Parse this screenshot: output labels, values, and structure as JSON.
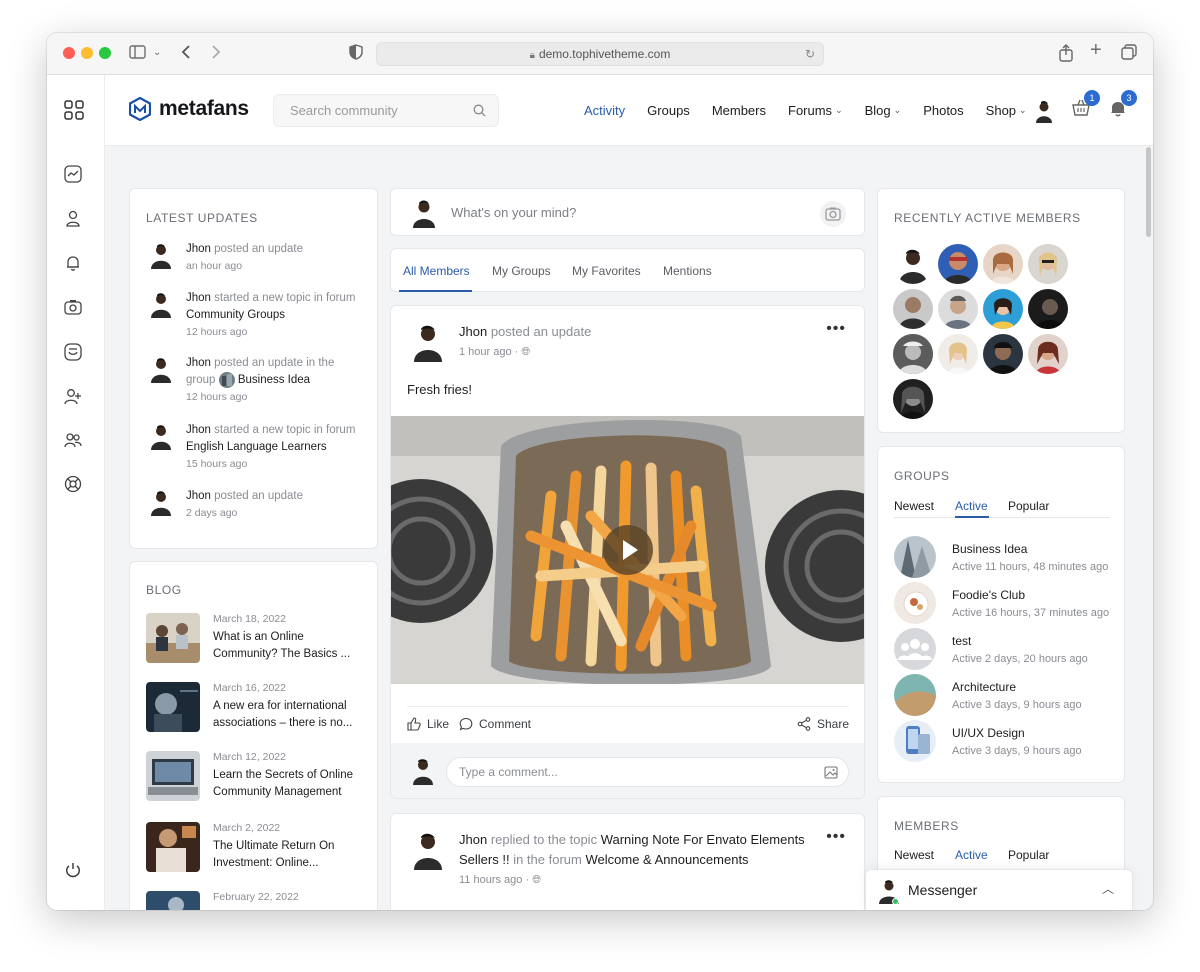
{
  "browser": {
    "url": "demo.tophivetheme.com"
  },
  "header": {
    "logo_text": "metafans",
    "search_placeholder": "Search community",
    "nav": [
      {
        "label": "Activity",
        "active": true,
        "dropdown": false
      },
      {
        "label": "Groups",
        "active": false,
        "dropdown": false
      },
      {
        "label": "Members",
        "active": false,
        "dropdown": false
      },
      {
        "label": "Forums",
        "active": false,
        "dropdown": true
      },
      {
        "label": "Blog",
        "active": false,
        "dropdown": true
      },
      {
        "label": "Photos",
        "active": false,
        "dropdown": false
      },
      {
        "label": "Shop",
        "active": false,
        "dropdown": true
      }
    ],
    "cart_count": "1",
    "notification_count": "3",
    "accent_color": "#2a5caa"
  },
  "latest_updates": {
    "title": "LATEST UPDATES",
    "items": [
      {
        "name": "Jhon",
        "action": "posted an update",
        "target": "",
        "time": "an hour ago"
      },
      {
        "name": "Jhon",
        "action": "started a new topic in forum",
        "target": "Community Groups",
        "time": "12 hours ago"
      },
      {
        "name": "Jhon",
        "action": "posted an update in the group",
        "target": "Business Idea",
        "time": "12 hours ago"
      },
      {
        "name": "Jhon",
        "action": "started a new topic in forum",
        "target": "English Language Learners",
        "time": "15 hours ago"
      },
      {
        "name": "Jhon",
        "action": "posted an update",
        "target": "",
        "time": "2 days ago"
      }
    ]
  },
  "blog": {
    "title": "BLOG",
    "items": [
      {
        "date": "March 18, 2022",
        "title": "What is an Online Community? The Basics ..."
      },
      {
        "date": "March 16, 2022",
        "title": "A new era for international associations – there is no..."
      },
      {
        "date": "March 12, 2022",
        "title": "Learn the Secrets of Online Community Management"
      },
      {
        "date": "March 2, 2022",
        "title": "The Ultimate Return On Investment: Online..."
      },
      {
        "date": "February 22, 2022",
        "title": ""
      }
    ]
  },
  "composer": {
    "placeholder": "What's on your mind?"
  },
  "feed_tabs": [
    "All Members",
    "My Groups",
    "My Favorites",
    "Mentions"
  ],
  "post1": {
    "name": "Jhon",
    "action": "posted an update",
    "time": "1 hour ago",
    "text": "Fresh fries!",
    "like": "Like",
    "comment": "Comment",
    "share": "Share",
    "comment_placeholder": "Type a comment..."
  },
  "post2": {
    "name": "Jhon",
    "action1": "replied to the topic",
    "topic": "Warning Note For Envato Elements Sellers !!",
    "action2": "in the forum",
    "forum": "Welcome & Announcements",
    "time": "11 hours ago"
  },
  "recent_members": {
    "title": "RECENTLY ACTIVE MEMBERS"
  },
  "groups": {
    "title": "GROUPS",
    "tabs": [
      "Newest",
      "Active",
      "Popular"
    ],
    "active_tab": "Active",
    "items": [
      {
        "name": "Business Idea",
        "active": "Active 11 hours, 48 minutes ago"
      },
      {
        "name": "Foodie's Club",
        "active": "Active 16 hours, 37 minutes ago"
      },
      {
        "name": "test",
        "active": "Active 2 days, 20 hours ago"
      },
      {
        "name": "Architecture",
        "active": "Active 3 days, 9 hours ago"
      },
      {
        "name": "UI/UX Design",
        "active": "Active 3 days, 9 hours ago"
      }
    ]
  },
  "members": {
    "title": "MEMBERS",
    "tabs": [
      "Newest",
      "Active",
      "Popular"
    ]
  },
  "messenger": {
    "label": "Messenger"
  }
}
